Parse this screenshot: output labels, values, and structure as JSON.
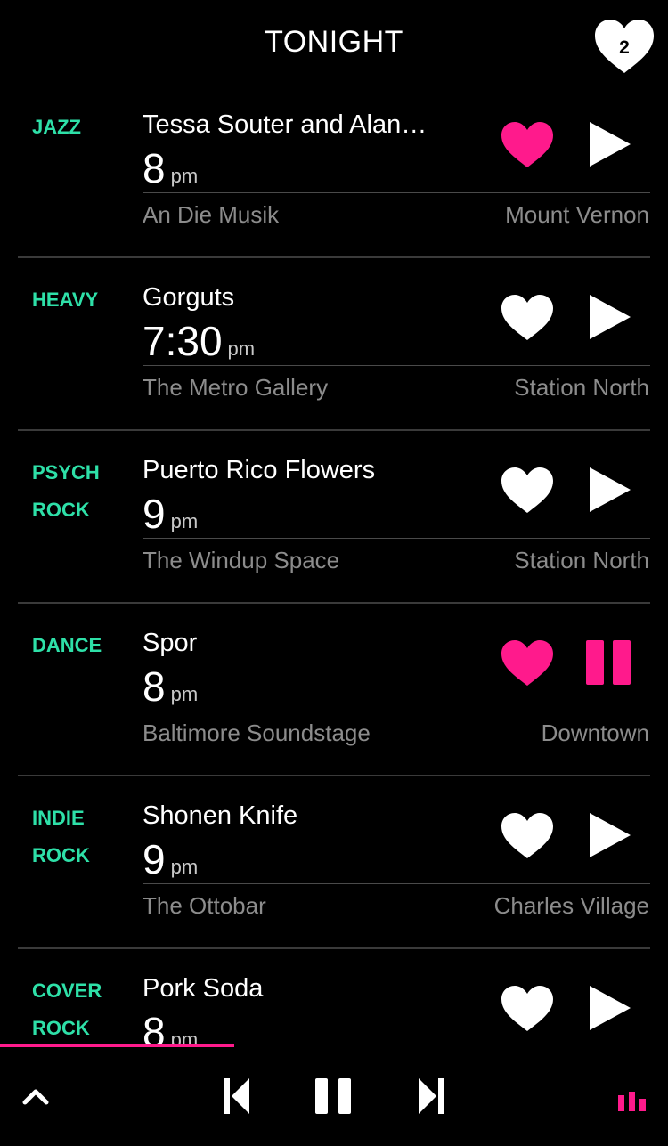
{
  "header": {
    "title": "TONIGHT",
    "favorites_count": "2"
  },
  "colors": {
    "accent_pink": "#ff1a8c",
    "genre_green": "#2ee0a8",
    "muted_text": "#8c8c8c"
  },
  "events": [
    {
      "genre": [
        "JAZZ"
      ],
      "title": "Tessa Souter and Alan…",
      "time": "8",
      "ampm": "pm",
      "venue": "An Die Musik",
      "neighborhood": "Mount Vernon",
      "favorited": true,
      "playing": false
    },
    {
      "genre": [
        "HEAVY"
      ],
      "title": "Gorguts",
      "time": "7:30",
      "ampm": "pm",
      "venue": "The Metro Gallery",
      "neighborhood": "Station North",
      "favorited": false,
      "playing": false
    },
    {
      "genre": [
        "PSYCH",
        "ROCK"
      ],
      "title": "Puerto Rico Flowers",
      "time": "9",
      "ampm": "pm",
      "venue": "The Windup Space",
      "neighborhood": "Station North",
      "favorited": false,
      "playing": false
    },
    {
      "genre": [
        "DANCE"
      ],
      "title": "Spor",
      "time": "8",
      "ampm": "pm",
      "venue": "Baltimore Soundstage",
      "neighborhood": "Downtown",
      "favorited": true,
      "playing": true
    },
    {
      "genre": [
        "INDIE",
        "ROCK"
      ],
      "title": "Shonen Knife",
      "time": "9",
      "ampm": "pm",
      "venue": "The Ottobar",
      "neighborhood": "Charles Village",
      "favorited": false,
      "playing": false
    },
    {
      "genre": [
        "COVER",
        "ROCK"
      ],
      "title": "Pork Soda",
      "time": "8",
      "ampm": "pm",
      "venue": "",
      "neighborhood": "",
      "favorited": false,
      "playing": false
    }
  ],
  "player": {
    "progress_fraction": 0.35,
    "icons": {
      "expand": "chevron-up-icon",
      "previous": "skip-previous-icon",
      "pause": "pause-icon",
      "next": "skip-next-icon",
      "playlist": "equalizer-icon"
    }
  }
}
